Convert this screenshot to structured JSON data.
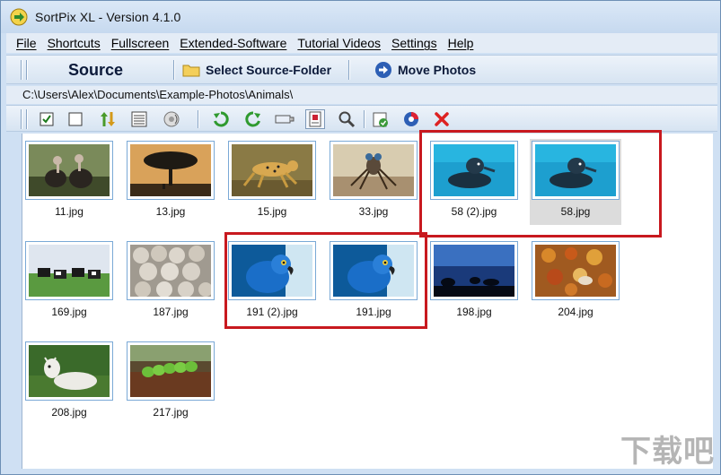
{
  "window": {
    "title": "SortPix XL - Version 4.1.0"
  },
  "menu": [
    "File",
    "Shortcuts",
    "Fullscreen",
    "Extended-Software",
    "Tutorial Videos",
    "Settings",
    "Help"
  ],
  "toolbar": {
    "source_label": "Source",
    "select_folder_label": "Select Source-Folder",
    "move_photos_label": "Move Photos"
  },
  "path": "C:\\Users\\Alex\\Documents\\Example-Photos\\Animals\\",
  "toolbar2_icons": [
    "check-all-icon",
    "uncheck-all-icon",
    "sort-icon",
    "details-view-icon",
    "audio-icon",
    "rotate-left-icon",
    "rotate-right-icon",
    "slideshow-icon",
    "preview-icon",
    "zoom-icon",
    "edit-icon",
    "compare-icon",
    "delete-icon"
  ],
  "photos": [
    {
      "name": "11.jpg",
      "scene": "vultures"
    },
    {
      "name": "13.jpg",
      "scene": "tree-sunset"
    },
    {
      "name": "15.jpg",
      "scene": "cheetah"
    },
    {
      "name": "33.jpg",
      "scene": "insect"
    },
    {
      "name": "58 (2).jpg",
      "scene": "seal"
    },
    {
      "name": "58.jpg",
      "scene": "seal",
      "selected": true
    },
    {
      "name": "169.jpg",
      "scene": "cows"
    },
    {
      "name": "187.jpg",
      "scene": "sheep"
    },
    {
      "name": "191 (2).jpg",
      "scene": "parrot"
    },
    {
      "name": "191.jpg",
      "scene": "parrot"
    },
    {
      "name": "198.jpg",
      "scene": "night-silhouette"
    },
    {
      "name": "204.jpg",
      "scene": "autumn-leaves"
    },
    {
      "name": "208.jpg",
      "scene": "goat"
    },
    {
      "name": "217.jpg",
      "scene": "caterpillar"
    }
  ],
  "highlight_color": "#c8191f",
  "watermark": "下载吧"
}
